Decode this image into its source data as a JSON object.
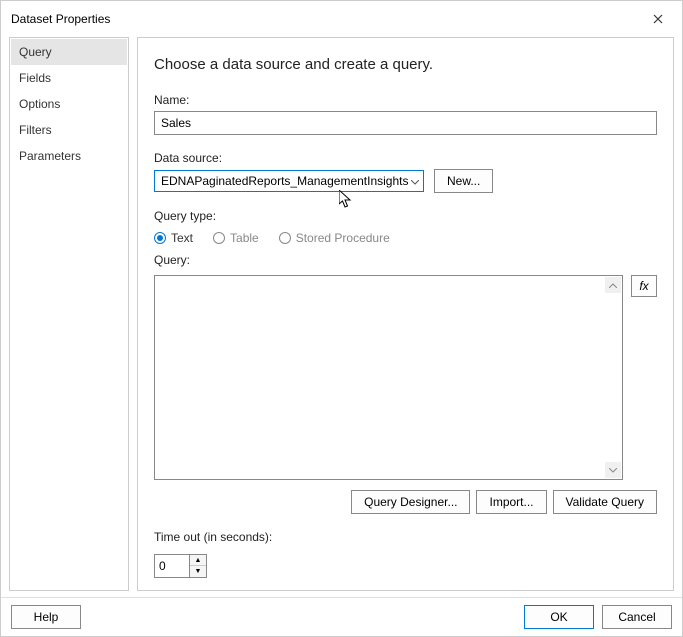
{
  "window": {
    "title": "Dataset Properties"
  },
  "sidebar": {
    "items": [
      {
        "label": "Query",
        "selected": true
      },
      {
        "label": "Fields"
      },
      {
        "label": "Options"
      },
      {
        "label": "Filters"
      },
      {
        "label": "Parameters"
      }
    ]
  },
  "main": {
    "heading": "Choose a data source and create a query.",
    "name": {
      "label": "Name:",
      "value": "Sales"
    },
    "datasource": {
      "label": "Data source:",
      "selected": "EDNAPaginatedReports_ManagementInsights",
      "new_button": "New..."
    },
    "querytype": {
      "label": "Query type:",
      "options": [
        {
          "label": "Text",
          "selected": true
        },
        {
          "label": "Table",
          "selected": false
        },
        {
          "label": "Stored Procedure",
          "selected": false
        }
      ]
    },
    "query": {
      "label": "Query:",
      "value": "",
      "fx": "fx"
    },
    "actions": {
      "query_designer": "Query Designer...",
      "import": "Import...",
      "validate": "Validate Query"
    },
    "timeout": {
      "label": "Time out (in seconds):",
      "value": "0"
    }
  },
  "footer": {
    "help": "Help",
    "ok": "OK",
    "cancel": "Cancel"
  }
}
